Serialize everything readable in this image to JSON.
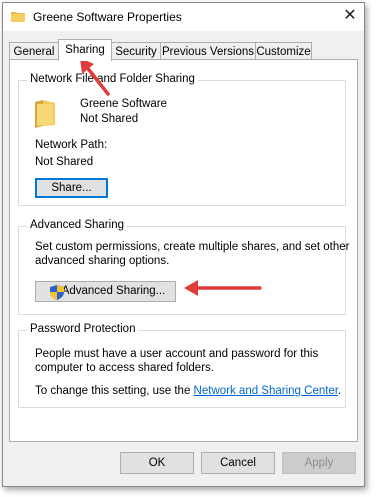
{
  "window": {
    "title": "Greene Software Properties",
    "close_label": "✕"
  },
  "tabs": [
    {
      "label": "General"
    },
    {
      "label": "Sharing",
      "active": true
    },
    {
      "label": "Security"
    },
    {
      "label": "Previous Versions"
    },
    {
      "label": "Customize"
    }
  ],
  "network_sharing": {
    "group_title": "Network File and Folder Sharing",
    "folder_name": "Greene Software",
    "folder_status": "Not Shared",
    "network_path_label": "Network Path:",
    "network_path_value": "Not Shared",
    "share_button": "Share..."
  },
  "advanced_sharing": {
    "group_title": "Advanced Sharing",
    "description_line1": "Set custom permissions, create multiple shares, and set other",
    "description_line2": "advanced sharing options.",
    "button_label": "Advanced Sharing..."
  },
  "password_protection": {
    "group_title": "Password Protection",
    "description_line1": "People must have a user account and password for this",
    "description_line2": "computer to access shared folders.",
    "change_prefix": "To change this setting, use the ",
    "link_text": "Network and Sharing Center",
    "change_suffix": "."
  },
  "footer": {
    "ok": "OK",
    "cancel": "Cancel",
    "apply": "Apply"
  },
  "colors": {
    "annotation_arrow": "#e03c3c",
    "link": "#0066cc",
    "focus": "#0078d7"
  }
}
